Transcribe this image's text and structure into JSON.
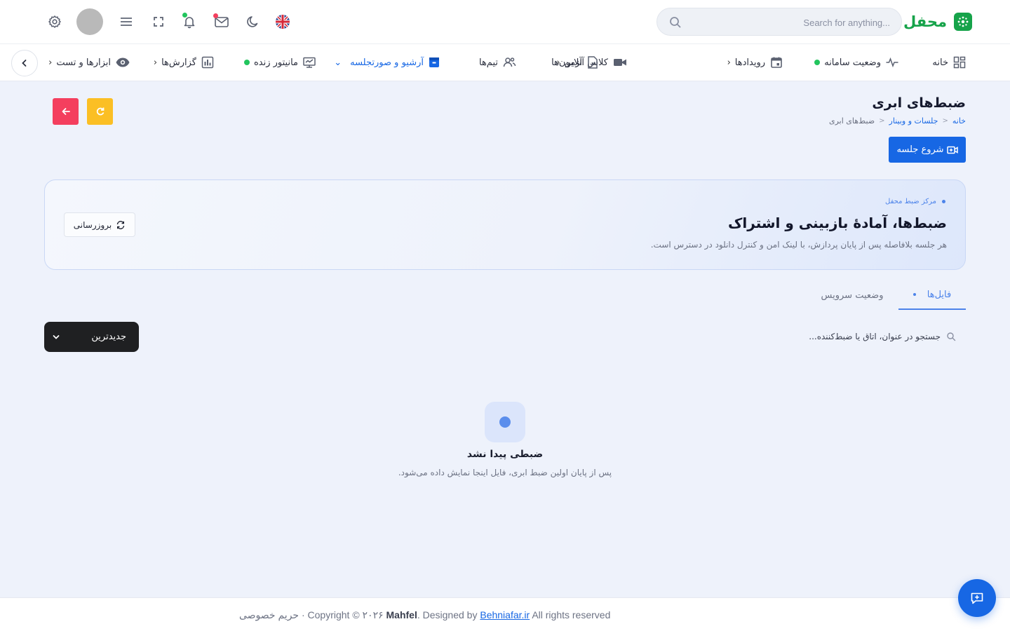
{
  "brand": {
    "name": "محفل",
    "icon": "brand-logo-icon",
    "color": "#16a34a"
  },
  "search": {
    "placeholder": "Search for anything..."
  },
  "topbar_icons": [
    "settings-icon",
    "avatar",
    "menu-icon",
    "fullscreen-icon",
    "bell-icon",
    "mail-icon",
    "moon-icon",
    "uk-flag-icon"
  ],
  "nav": {
    "items": [
      {
        "label": "خانه",
        "icon": "dashboard-icon"
      },
      {
        "label": "وضعیت سامانه",
        "icon": "pulse-icon",
        "live": true
      },
      {
        "label": "رویدادها",
        "icon": "calendar-icon",
        "has_children": true
      },
      {
        "label": "کلاس آنلاین",
        "icon": "video-icon",
        "has_children": true
      },
      {
        "label": "آزمون‌ها",
        "icon": "exam-icon"
      },
      {
        "label": "تیم‌ها",
        "icon": "team-icon"
      },
      {
        "label": "آرشیو و صورتجلسه",
        "icon": "archive-icon",
        "has_children": true,
        "active": true
      },
      {
        "label": "مانیتور زنده",
        "icon": "monitor-icon",
        "live": true
      },
      {
        "label": "گزارش‌ها",
        "icon": "report-icon",
        "has_children": true
      },
      {
        "label": "ابزارها و تست",
        "icon": "eye-icon",
        "has_children": true
      }
    ]
  },
  "page": {
    "title": "ضبط‌های ابری",
    "breadcrumb": [
      "خانه",
      "جلسات و وبینار",
      "ضبط‌های ابری"
    ],
    "start_button": "شروع جلسه"
  },
  "hero": {
    "kicker": "مرکز ضبط محفل",
    "title": "ضبط‌ها، آمادهٔ بازبینی و اشتراک",
    "subtitle": "هر جلسه بلافاصله پس از پایان پردازش، با لینک امن و کنترل دانلود در دسترس است.",
    "refresh_label": "بروزرسانی"
  },
  "tabs": [
    {
      "label": "فایل‌ها",
      "active": true
    },
    {
      "label": "وضعیت سرویس",
      "active": false
    }
  ],
  "filter": {
    "search_placeholder": "جستجو در عنوان، اتاق یا ضبط‌کننده...",
    "sort_selected": "جدیدترین"
  },
  "empty_state": {
    "title": "ضبطی پیدا نشد",
    "subtitle": "پس از پایان اولین ضبط ابری، فایل اینجا نمایش داده می‌شود."
  },
  "footer": {
    "privacy": "حریم خصوصی",
    "copyright": "· Copyright © ۲۰۲۶",
    "brand": "Mahfel",
    "designed_by": ". Designed by",
    "designer": "Behniafar.ir",
    "rights": "All rights reserved"
  },
  "colors": {
    "primary": "#1767e4",
    "warning": "#fbbf24",
    "danger": "#f43f5e",
    "live": "#22c55e",
    "background": "#eef2fb"
  }
}
